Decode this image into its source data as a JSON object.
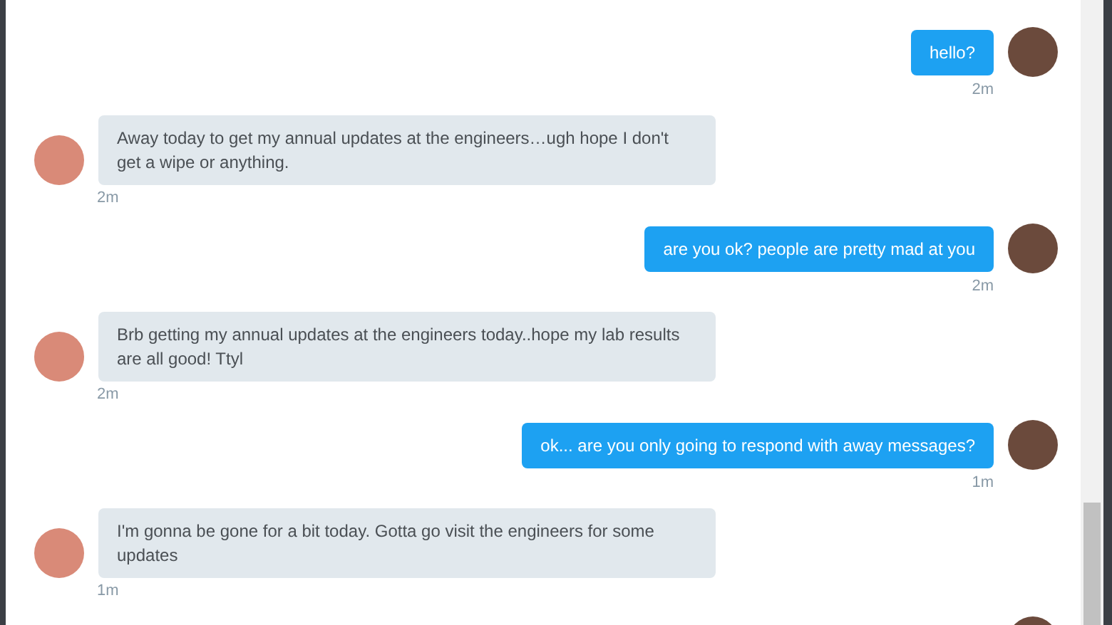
{
  "messages": [
    {
      "kind": "sent",
      "text": "hello?",
      "time": "2m"
    },
    {
      "kind": "received",
      "text": "Away today to get my annual updates at the engineers…ugh hope I don't get a wipe or anything.",
      "time": "2m"
    },
    {
      "kind": "sent",
      "text": "are you ok? people are pretty mad at you",
      "time": "2m"
    },
    {
      "kind": "received",
      "text": "Brb getting my annual updates at the engineers today..hope my lab results are all good! Ttyl",
      "time": "2m"
    },
    {
      "kind": "sent",
      "text": "ok... are you only going to respond with away messages?",
      "time": "1m"
    },
    {
      "kind": "received",
      "text": "I'm gonna be gone for a bit today. Gotta go visit the engineers for some updates",
      "time": "1m"
    },
    {
      "kind": "sent"
    }
  ]
}
